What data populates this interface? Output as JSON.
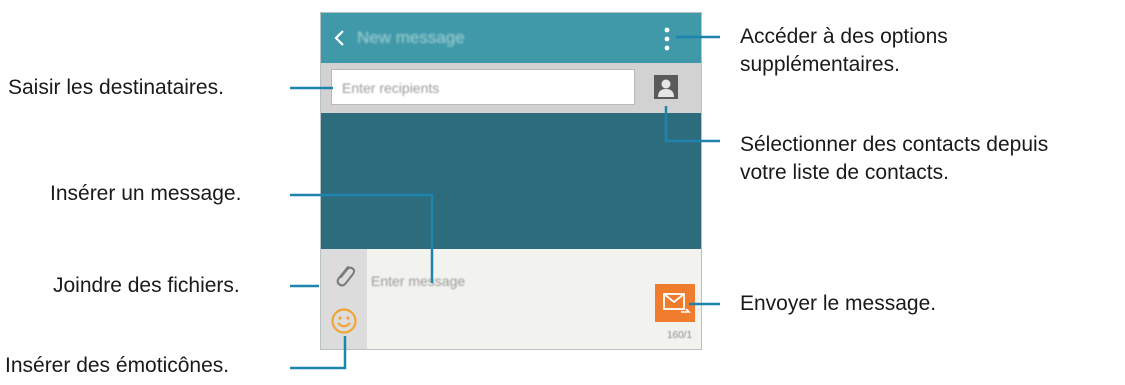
{
  "screen": {
    "header": {
      "title": "New message",
      "back_icon": "chevron-left-icon",
      "more_icon": "vertical-dots-icon"
    },
    "recipients": {
      "placeholder": "Enter recipients",
      "contact_icon": "contact-card-icon"
    },
    "compose": {
      "placeholder": "Enter message",
      "attach_icon": "paperclip-icon",
      "emoji_icon": "smiley-icon",
      "send_icon": "envelope-send-icon",
      "send_counter": "160/1"
    }
  },
  "callouts": {
    "options": [
      "Accéder à des options",
      "supplémentaires."
    ],
    "recipients": "Saisir les destinataires.",
    "contacts": [
      "Sélectionner des contacts depuis",
      "votre liste de contacts."
    ],
    "message": "Insérer un message.",
    "attach": "Joindre des fichiers.",
    "send": "Envoyer le message.",
    "emoticons": "Insérer des émoticônes."
  },
  "colors": {
    "header": "#3f99a8",
    "body": "#2d6c7d",
    "leader_line": "#1e83ad",
    "send_button": "#ef7d2d",
    "emoji_icon": "#f0a434"
  }
}
